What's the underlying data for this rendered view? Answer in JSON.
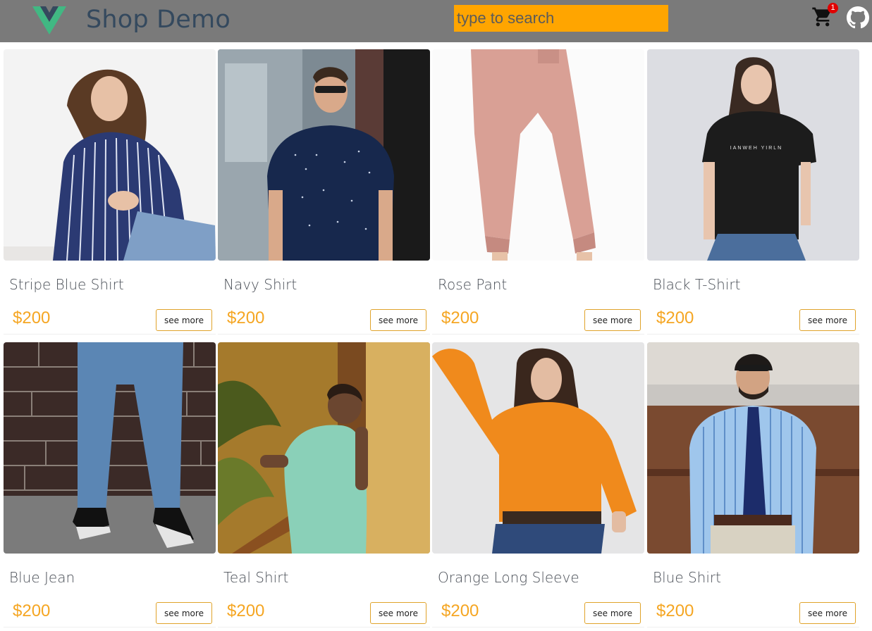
{
  "header": {
    "brand": "Shop Demo",
    "search_placeholder": "type to search",
    "cart_count": "1",
    "icons": {
      "logo": "vue-logo",
      "cart": "shopping-cart-icon",
      "github": "github-icon"
    },
    "colors": {
      "header_bg": "#7a7a7a",
      "search_bg": "#ffa500",
      "badge_bg": "#e00000",
      "price": "#f5a623"
    }
  },
  "products": [
    {
      "name": "Stripe Blue Shirt",
      "price": "$200",
      "action": "see more"
    },
    {
      "name": "Navy Shirt",
      "price": "$200",
      "action": "see more"
    },
    {
      "name": "Rose Pant",
      "price": "$200",
      "action": "see more"
    },
    {
      "name": "Black T-Shirt",
      "price": "$200",
      "action": "see more"
    },
    {
      "name": "Blue Jean",
      "price": "$200",
      "action": "see more"
    },
    {
      "name": "Teal Shirt",
      "price": "$200",
      "action": "see more"
    },
    {
      "name": "Orange Long Sleeve",
      "price": "$200",
      "action": "see more"
    },
    {
      "name": "Blue Shirt",
      "price": "$200",
      "action": "see more"
    }
  ]
}
